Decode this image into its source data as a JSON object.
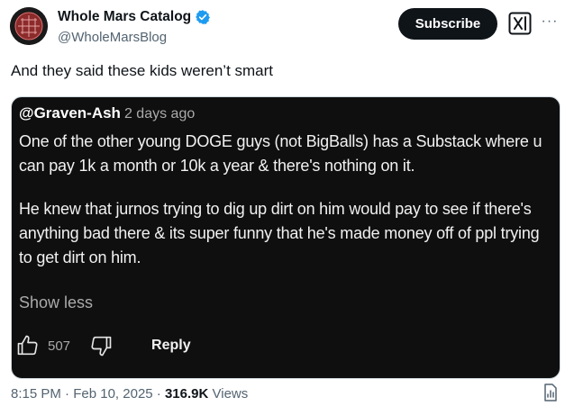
{
  "author": {
    "display_name": "Whole Mars Catalog",
    "handle": "@WholeMarsBlog",
    "verified": true
  },
  "header": {
    "subscribe_label": "Subscribe",
    "grok_icon": "grok-icon",
    "more_icon": "more-icon",
    "more_glyph": "···"
  },
  "tweet": {
    "text": "And they said these kids weren’t smart"
  },
  "embedded_comment": {
    "username": "@Graven-Ash",
    "time_ago": "2 days ago",
    "paragraphs": [
      "One of the other young DOGE guys (not BigBalls) has a Substack where u can pay 1k a month or 10k a year & there's nothing on it.",
      "He knew that jurnos trying to dig up dirt on him would pay to see if there's anything bad there & its super funny that he's made money off of ppl trying to get dirt on him."
    ],
    "show_less_label": "Show less",
    "like_count": "507",
    "reply_label": "Reply"
  },
  "footer": {
    "time": "8:15 PM",
    "separator1": " · ",
    "date": "Feb 10, 2025",
    "separator2": " · ",
    "views_count": "316.9K",
    "views_label": "Views"
  },
  "colors": {
    "verified_badge": "#1d9bf0",
    "text_primary": "#0f1419",
    "text_secondary": "#536471",
    "media_background": "#0f0f0f"
  }
}
